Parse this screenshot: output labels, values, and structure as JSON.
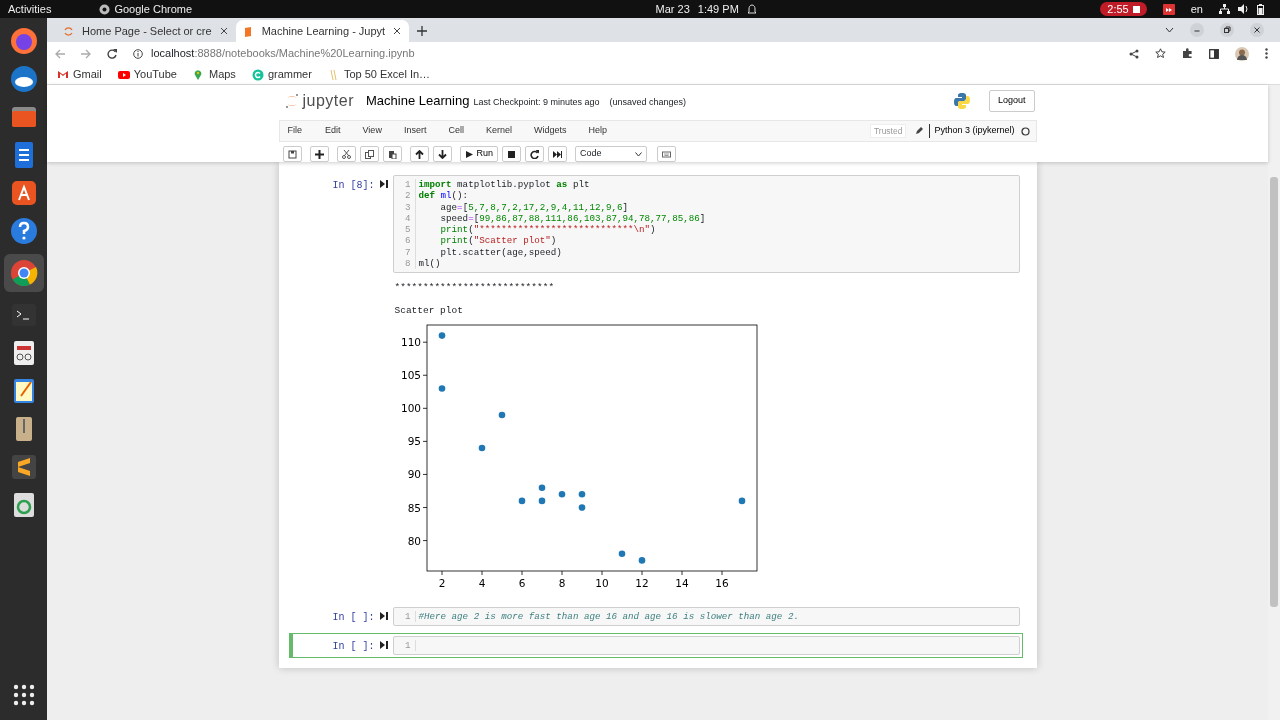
{
  "system_bar": {
    "activities": "Activities",
    "app_name": "Google Chrome",
    "date": "Mar 23",
    "time": "1:49 PM",
    "recording": "2:55",
    "language": "en"
  },
  "browser": {
    "tabs": [
      {
        "title": "Home Page - Select or cre",
        "selected": false
      },
      {
        "title": "Machine Learning - Jupyt",
        "selected": true
      }
    ],
    "url_host": "localhost",
    "url_rest": ":8888/notebooks/Machine%20Learning.ipynb",
    "bookmarks": [
      {
        "label": "Gmail",
        "kind": "mail"
      },
      {
        "label": "YouTube",
        "kind": "video"
      },
      {
        "label": "Maps",
        "kind": "pin"
      },
      {
        "label": "grammer",
        "kind": "g"
      },
      {
        "label": "Top 50 Excel In…",
        "kind": "doc"
      }
    ]
  },
  "notebook": {
    "logo_text": "jupyter",
    "name": "Machine Learning",
    "checkpoint": "Last Checkpoint: 9 minutes ago",
    "unsaved": "(unsaved changes)",
    "logout": "Logout",
    "menu": [
      "File",
      "Edit",
      "View",
      "Insert",
      "Cell",
      "Kernel",
      "Widgets",
      "Help"
    ],
    "trusted": "Trusted",
    "kernel": "Python 3 (ipykernel)",
    "run_label": "Run",
    "cell_type": "Code",
    "cells": [
      {
        "prompt": "In [8]:",
        "selected": false,
        "lines": [
          [
            {
              "kind": "kw",
              "t": "import"
            },
            {
              "kind": "plain",
              "t": " matplotlib.pyplot "
            },
            {
              "kind": "kw",
              "t": "as"
            },
            {
              "kind": "plain",
              "t": " plt"
            }
          ],
          [
            {
              "kind": "kw",
              "t": "def"
            },
            {
              "kind": "def",
              "t": " ml"
            },
            {
              "kind": "plain",
              "t": "():"
            }
          ],
          [
            {
              "kind": "plain",
              "t": "    age"
            },
            {
              "kind": "op",
              "t": "="
            },
            {
              "kind": "plain",
              "t": "["
            },
            {
              "kind": "num",
              "t": "5,7,8,7,2,17,2,9,4,11,12,9,6"
            },
            {
              "kind": "plain",
              "t": "]"
            }
          ],
          [
            {
              "kind": "plain",
              "t": "    speed"
            },
            {
              "kind": "op",
              "t": "="
            },
            {
              "kind": "plain",
              "t": "["
            },
            {
              "kind": "num",
              "t": "99,86,87,88,111,86,103,87,94,78,77,85,86"
            },
            {
              "kind": "plain",
              "t": "]"
            }
          ],
          [
            {
              "kind": "builtin",
              "t": "    print"
            },
            {
              "kind": "plain",
              "t": "("
            },
            {
              "kind": "str",
              "t": "\"****************************\\n\""
            },
            {
              "kind": "plain",
              "t": ")"
            }
          ],
          [
            {
              "kind": "builtin",
              "t": "    print"
            },
            {
              "kind": "plain",
              "t": "("
            },
            {
              "kind": "str",
              "t": "\"Scatter plot\""
            },
            {
              "kind": "plain",
              "t": ")"
            }
          ],
          [
            {
              "kind": "plain",
              "t": "    plt.scatter(age,speed)"
            }
          ],
          [
            {
              "kind": "plain",
              "t": "ml()"
            }
          ]
        ],
        "line_numbers": [
          "1",
          "2",
          "3",
          "4",
          "5",
          "6",
          "7",
          "8"
        ],
        "output": {
          "stdout": [
            "****************************",
            "Scatter plot"
          ],
          "chart_data": {
            "type": "scatter",
            "xlim": [
              1.25,
              17.75
            ],
            "ylim": [
              75.4,
              112.6
            ],
            "xticks": [
              2,
              4,
              6,
              8,
              10,
              12,
              14,
              16
            ],
            "yticks": [
              80,
              85,
              90,
              95,
              100,
              105,
              110
            ],
            "series": [
              {
                "color": "#1f77b4",
                "x": [
                  5,
                  7,
                  8,
                  7,
                  2,
                  17,
                  2,
                  9,
                  4,
                  11,
                  12,
                  9,
                  6
                ],
                "values": [
                  99,
                  86,
                  87,
                  88,
                  111,
                  86,
                  103,
                  87,
                  94,
                  78,
                  77,
                  85,
                  86
                ]
              }
            ]
          }
        }
      },
      {
        "prompt": "In [ ]:",
        "selected": false,
        "lines": [
          [
            {
              "kind": "comment",
              "t": "#Here age 2 is more fast than age 16 and age 16 is slower than age 2."
            }
          ]
        ],
        "line_numbers": [
          "1"
        ]
      },
      {
        "prompt": "In [ ]:",
        "selected": true,
        "line_numbers": [
          "1"
        ]
      }
    ]
  }
}
